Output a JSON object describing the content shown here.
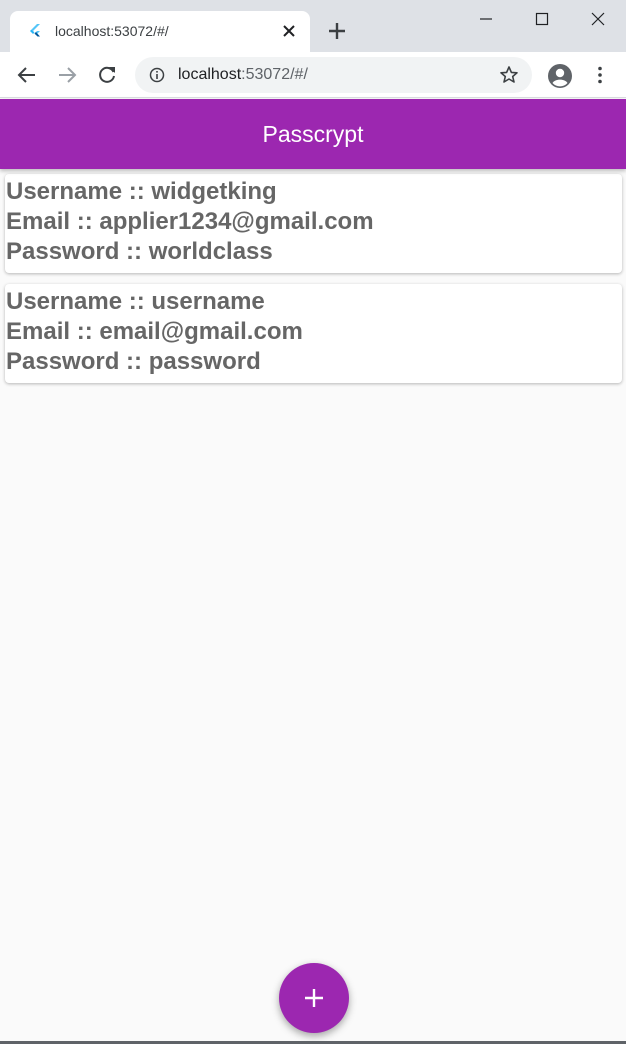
{
  "browser": {
    "tab_title": "localhost:53072/#/",
    "url_host": "localhost",
    "url_rest": ":53072/#/",
    "favicon": "flutter-logo-icon",
    "theme_color": "#dee1e6"
  },
  "app": {
    "title": "Passcrypt",
    "primary_color": "#9c27b0",
    "background_color": "#fafafa",
    "fab_icon": "plus-icon"
  },
  "entries": [
    {
      "username": "Username :: widgetking",
      "email": "Email :: applier1234@gmail.com",
      "password": "Password :: worldclass"
    },
    {
      "username": "Username :: username",
      "email": "Email :: email@gmail.com",
      "password": "Password :: password"
    }
  ]
}
